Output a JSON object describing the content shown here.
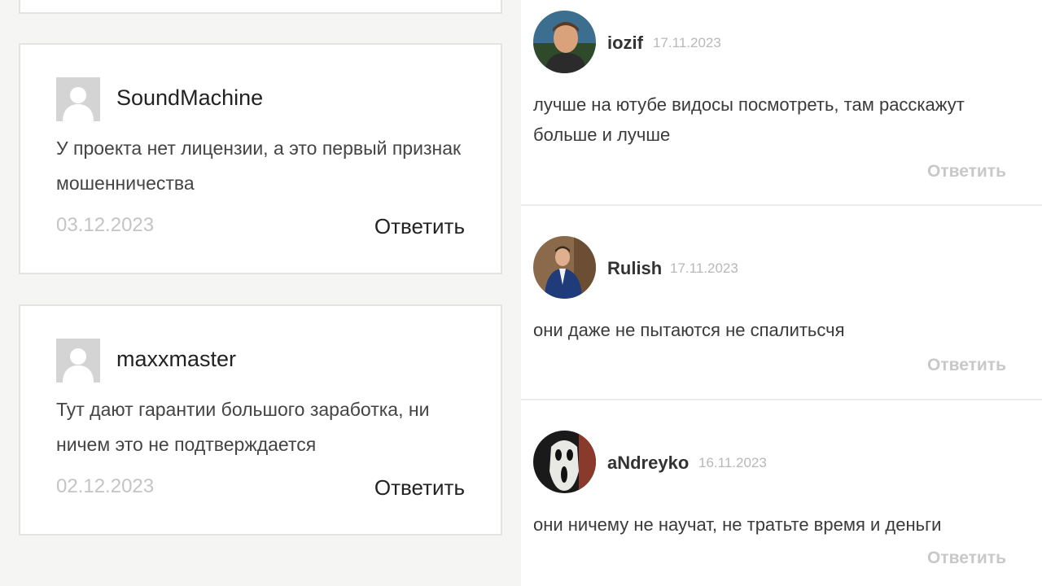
{
  "left_comments": [
    {
      "author": "SoundMachine",
      "text": "У проекта нет лицензии, а это первый признак мошенничества",
      "date": "03.12.2023",
      "reply_label": "Ответить"
    },
    {
      "author": "maxxmaster",
      "text": "Тут дают гарантии большого заработка, ни ничем это не подтверждается",
      "date": "02.12.2023",
      "reply_label": "Ответить"
    }
  ],
  "right_comments": [
    {
      "author": "iozif",
      "date": "17.11.2023",
      "text": "лучше на ютубе видосы посмотреть, там расскажут больше и лучше",
      "reply_label": "Ответить"
    },
    {
      "author": "Rulish",
      "date": "17.11.2023",
      "text": "они даже не пытаются не спалитьсчя",
      "reply_label": "Ответить"
    },
    {
      "author": "aNdreyko",
      "date": "16.11.2023",
      "text": "они ничему не научат, не тратьте время и деньги",
      "reply_label": "Ответить"
    }
  ],
  "colors": {
    "page_bg": "#f5f5f3",
    "card_border": "#e4e4e0",
    "date_gray": "#c4c4c4",
    "reply_gray": "#c8c8c8"
  }
}
